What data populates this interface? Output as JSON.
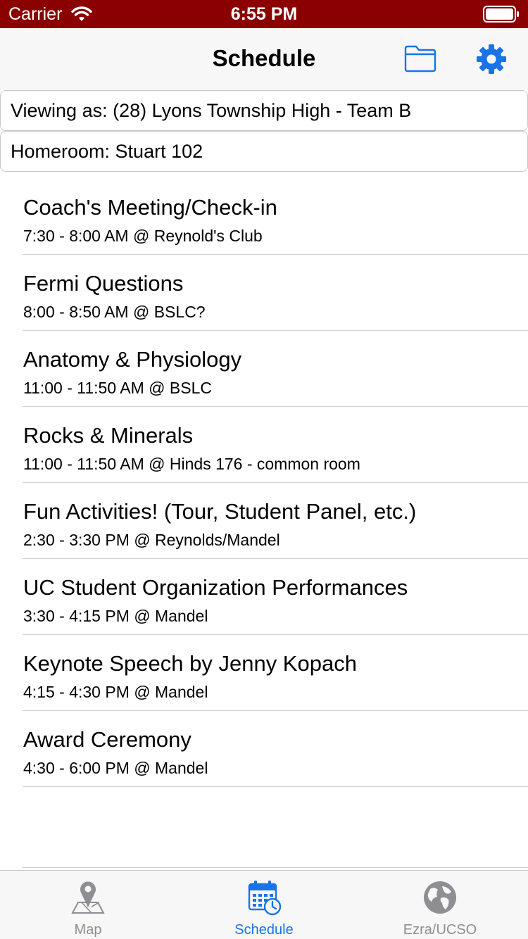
{
  "status_bar": {
    "carrier": "Carrier",
    "time": "6:55 PM",
    "background_color": "#8b0000"
  },
  "nav": {
    "title": "Schedule",
    "folder_icon": "folder-icon",
    "settings_icon": "gear-icon",
    "accent_color": "#1a73e8"
  },
  "viewing_as": "Viewing as: (28) Lyons Township High - Team B",
  "homeroom": "Homeroom: Stuart 102",
  "schedule": [
    {
      "title": "Coach's Meeting/Check-in",
      "detail": "7:30 - 8:00 AM @ Reynold's Club"
    },
    {
      "title": "Fermi Questions",
      "detail": "8:00 - 8:50 AM @ BSLC?"
    },
    {
      "title": "Anatomy & Physiology",
      "detail": "11:00 - 11:50 AM @ BSLC"
    },
    {
      "title": "Rocks & Minerals",
      "detail": "11:00 - 11:50 AM @ Hinds 176 - common room"
    },
    {
      "title": "Fun Activities! (Tour, Student Panel, etc.)",
      "detail": "2:30 - 3:30 PM @ Reynolds/Mandel"
    },
    {
      "title": "UC Student Organization Performances",
      "detail": "3:30 - 4:15 PM @ Mandel"
    },
    {
      "title": "Keynote Speech by Jenny Kopach",
      "detail": "4:15 - 4:30 PM @ Mandel"
    },
    {
      "title": "Award Ceremony",
      "detail": "4:30 - 6:00 PM @ Mandel"
    }
  ],
  "tabs": [
    {
      "label": "Map",
      "icon": "map-pin-icon"
    },
    {
      "label": "Schedule",
      "icon": "calendar-clock-icon",
      "selected": true
    },
    {
      "label": "Ezra/UCSO",
      "icon": "globe-icon"
    }
  ]
}
